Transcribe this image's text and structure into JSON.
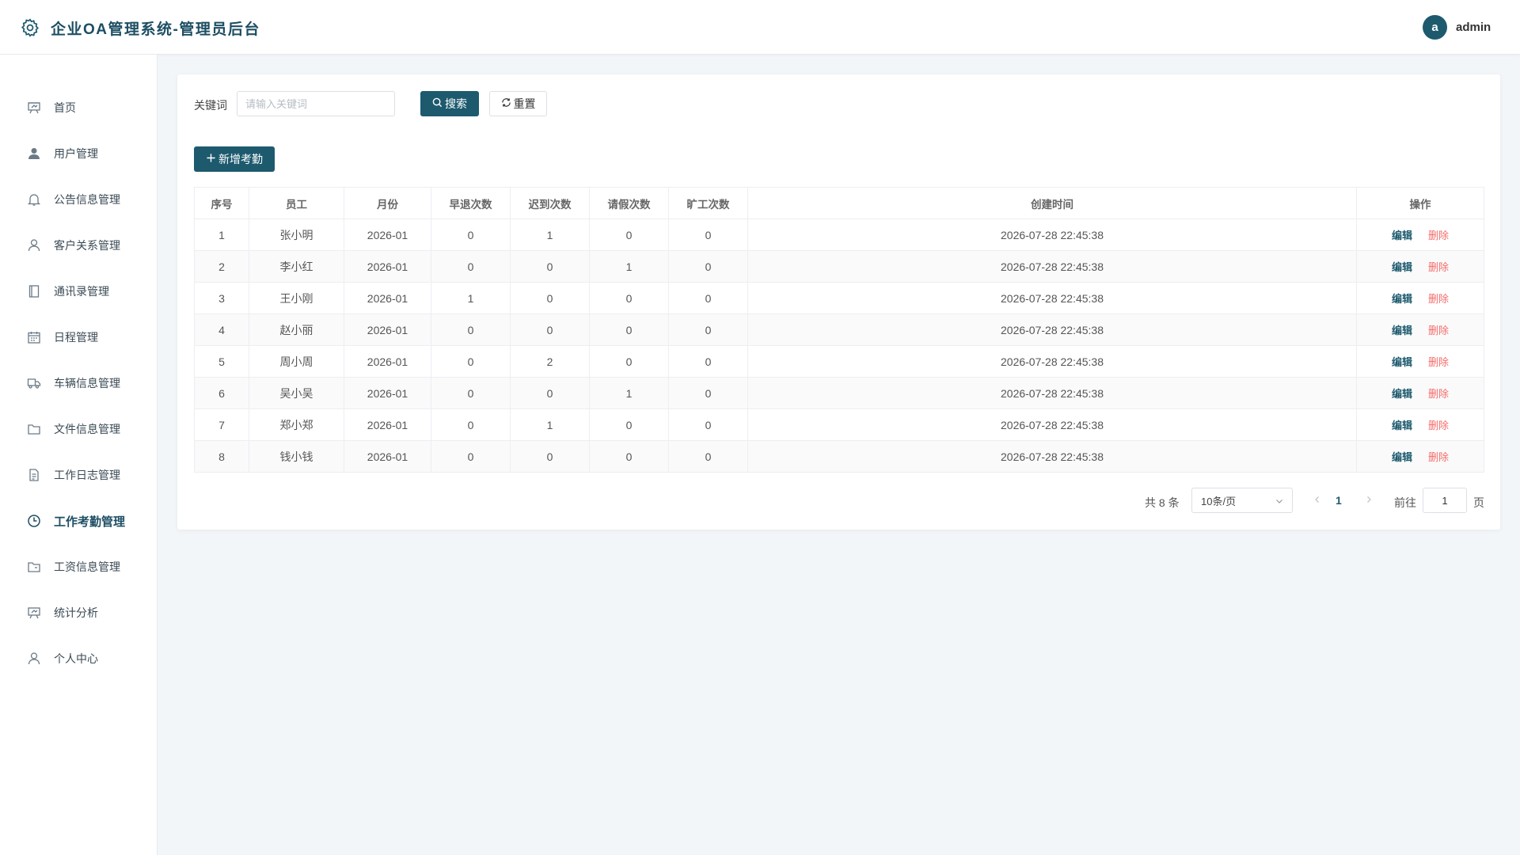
{
  "header": {
    "title": "企业OA管理系统-管理员后台",
    "avatar_letter": "a",
    "username": "admin"
  },
  "sidebar": {
    "items": [
      {
        "label": "首页",
        "icon": "presentation-icon"
      },
      {
        "label": "用户管理",
        "icon": "user-filled-icon"
      },
      {
        "label": "公告信息管理",
        "icon": "bell-icon"
      },
      {
        "label": "客户关系管理",
        "icon": "user-icon"
      },
      {
        "label": "通讯录管理",
        "icon": "notebook-icon"
      },
      {
        "label": "日程管理",
        "icon": "calendar-icon"
      },
      {
        "label": "车辆信息管理",
        "icon": "truck-icon"
      },
      {
        "label": "文件信息管理",
        "icon": "folder-icon"
      },
      {
        "label": "工作日志管理",
        "icon": "document-icon"
      },
      {
        "label": "工作考勤管理",
        "icon": "clock-icon",
        "active": true
      },
      {
        "label": "工资信息管理",
        "icon": "folder-opened-icon"
      },
      {
        "label": "统计分析",
        "icon": "presentation-icon"
      },
      {
        "label": "个人中心",
        "icon": "user-icon"
      }
    ]
  },
  "search": {
    "label": "关键词",
    "placeholder": "请输入关键词",
    "search_button": "搜索",
    "reset_button": "重置"
  },
  "add_button": "新增考勤",
  "table": {
    "columns": [
      "序号",
      "员工",
      "月份",
      "早退次数",
      "迟到次数",
      "请假次数",
      "旷工次数",
      "创建时间",
      "操作"
    ],
    "edit_label": "编辑",
    "delete_label": "删除",
    "rows": [
      [
        "1",
        "张小明",
        "2026-01",
        "0",
        "1",
        "0",
        "0",
        "2026-07-28 22:45:38"
      ],
      [
        "2",
        "李小红",
        "2026-01",
        "0",
        "0",
        "1",
        "0",
        "2026-07-28 22:45:38"
      ],
      [
        "3",
        "王小刚",
        "2026-01",
        "1",
        "0",
        "0",
        "0",
        "2026-07-28 22:45:38"
      ],
      [
        "4",
        "赵小丽",
        "2026-01",
        "0",
        "0",
        "0",
        "0",
        "2026-07-28 22:45:38"
      ],
      [
        "5",
        "周小周",
        "2026-01",
        "0",
        "2",
        "0",
        "0",
        "2026-07-28 22:45:38"
      ],
      [
        "6",
        "吴小吴",
        "2026-01",
        "0",
        "0",
        "1",
        "0",
        "2026-07-28 22:45:38"
      ],
      [
        "7",
        "郑小郑",
        "2026-01",
        "0",
        "1",
        "0",
        "0",
        "2026-07-28 22:45:38"
      ],
      [
        "8",
        "钱小钱",
        "2026-01",
        "0",
        "0",
        "0",
        "0",
        "2026-07-28 22:45:38"
      ]
    ]
  },
  "pagination": {
    "total_text": "共 8 条",
    "page_size": "10条/页",
    "current_page": "1",
    "goto_prefix": "前往",
    "goto_value": "1",
    "goto_suffix": "页"
  },
  "colors": {
    "primary": "#1d5a6e",
    "danger": "#f56c6c",
    "background": "#f3f6f9"
  }
}
